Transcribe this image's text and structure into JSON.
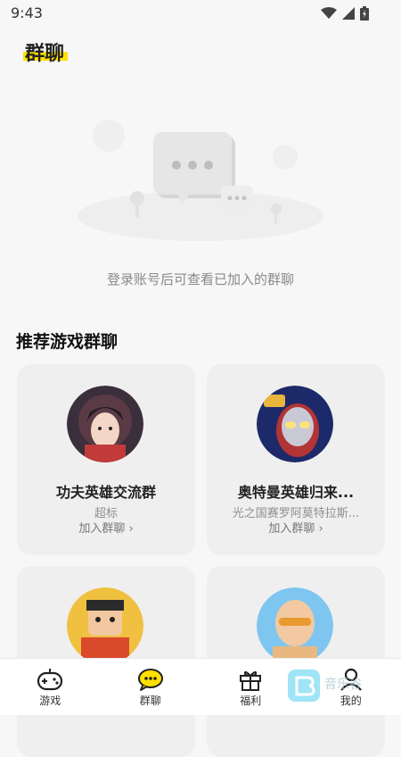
{
  "status_bar": {
    "time": "9:43"
  },
  "header": {
    "title": "群聊"
  },
  "empty_state": {
    "message": "登录账号后可查看已加入的群聊"
  },
  "recommend": {
    "title": "推荐游戏群聊",
    "groups": [
      {
        "name": "功夫英雄交流群",
        "sub": "超标",
        "join": "加入群聊 ›"
      },
      {
        "name": "奥特曼英雄归来...",
        "sub": "光之国赛罗阿莫特拉斯...",
        "join": "加入群聊 ›"
      },
      {
        "name": "",
        "sub": "",
        "join": ""
      },
      {
        "name": "",
        "sub": "",
        "join": ""
      }
    ]
  },
  "bottom_nav": [
    {
      "label": "游戏",
      "icon": "gamepad-icon"
    },
    {
      "label": "群聊",
      "icon": "chat-bubble-icon",
      "active": true
    },
    {
      "label": "福利",
      "icon": "gift-icon"
    },
    {
      "label": "我的",
      "icon": "user-icon"
    }
  ],
  "watermark": {
    "text": "音乐谷"
  },
  "colors": {
    "accent": "#ffe000",
    "card_bg": "#efefef",
    "page_bg": "#f7f7f7"
  }
}
